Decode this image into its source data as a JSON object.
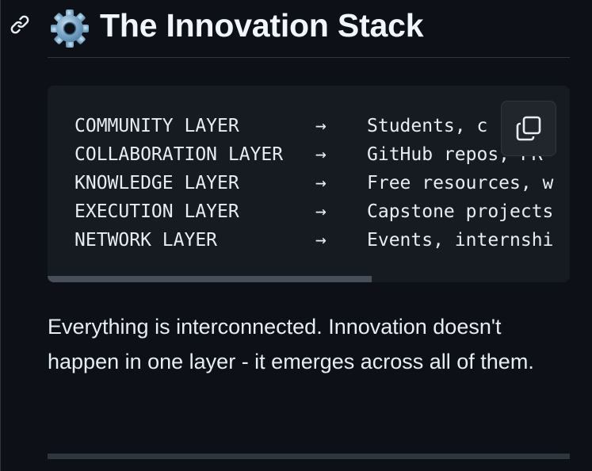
{
  "heading": {
    "emoji": "⚙️",
    "title": "The Innovation Stack",
    "anchor_icon": "link-icon"
  },
  "code_block": {
    "lines": [
      {
        "label": "COMMUNITY LAYER",
        "arrow": "→",
        "desc": "Students, c"
      },
      {
        "label": "COLLABORATION LAYER",
        "arrow": "→",
        "desc": "GitHub repos, PR"
      },
      {
        "label": "KNOWLEDGE LAYER",
        "arrow": "→",
        "desc": "Free resources, w"
      },
      {
        "label": "EXECUTION LAYER",
        "arrow": "→",
        "desc": "Capstone projects"
      },
      {
        "label": "NETWORK LAYER",
        "arrow": "→",
        "desc": "Events, internshi"
      }
    ],
    "copy_icon": "copy-icon",
    "scroll_position": 0,
    "visible_fraction": 0.62
  },
  "paragraph": {
    "text": "Everything is interconnected. Innovation doesn't happen in one layer - it emerges across all of them."
  },
  "colors": {
    "background": "#0d1117",
    "code_background": "#161b22",
    "text": "#e6edf3",
    "border": "#30363d"
  }
}
